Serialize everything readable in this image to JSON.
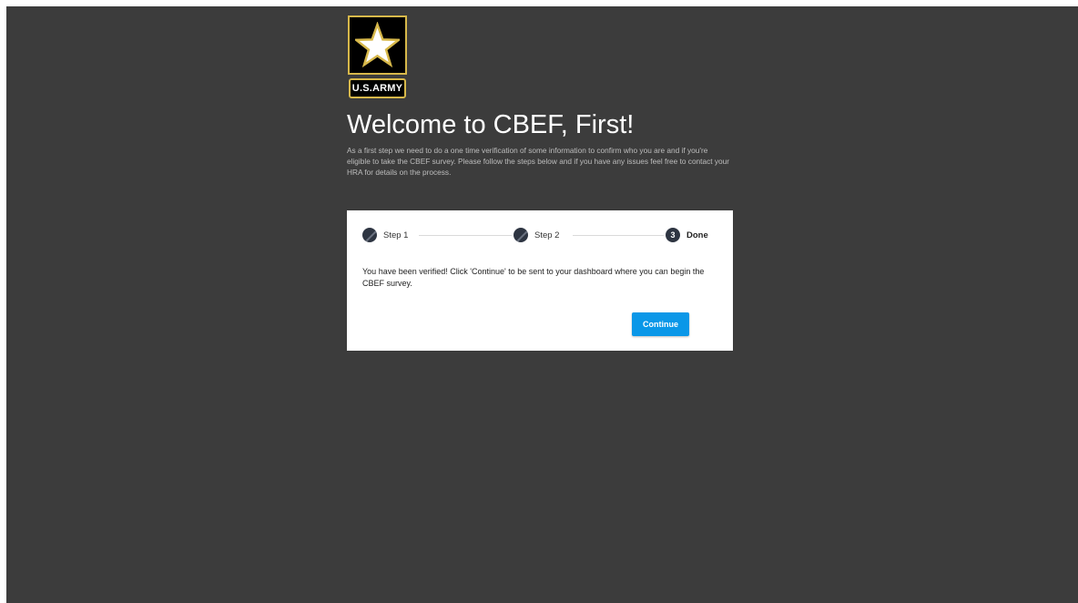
{
  "logo": {
    "icon": "army-star-icon",
    "text": "U.S.ARMY"
  },
  "header": {
    "title": "Welcome to CBEF, First!",
    "intro": "As a first step we need to do a one time verification of some information to confirm who you are and if you're eligible to take the CBEF survey. Please follow the steps below and if you have any issues feel free to contact your HRA for details on the process."
  },
  "stepper": {
    "steps": [
      {
        "label": "Step 1",
        "state": "complete"
      },
      {
        "label": "Step 2",
        "state": "complete"
      },
      {
        "label": "Done",
        "number": "3",
        "state": "active"
      }
    ]
  },
  "card": {
    "message": "You have been verified! Click 'Continue' to be sent to your dashboard where you can begin the CBEF survey.",
    "continue_label": "Continue"
  },
  "colors": {
    "background": "#3c3c3c",
    "accent": "#0a97e8",
    "logo_gold": "#d7b84a",
    "step_dot": "#2e3542"
  }
}
